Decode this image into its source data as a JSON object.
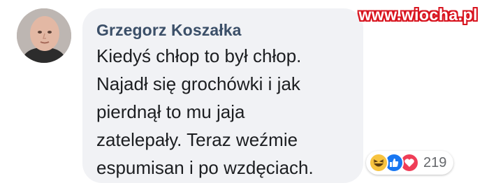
{
  "watermark": "www.wiocha.pl",
  "comment": {
    "author": "Grzegorz Koszałka",
    "lines": [
      "Kiedyś chłop to był chłop.",
      "Najadł się grochówki i jak",
      "pierdnął to mu jaja",
      "zatelepały. Teraz weźmie",
      "espumisan i po wzdęciach."
    ]
  },
  "reactions": {
    "icons": [
      "haha-icon",
      "like-icon",
      "love-icon"
    ],
    "count": "219"
  },
  "colors": {
    "bubble": "#f1f2f5",
    "author": "#3b4f68",
    "like": "#1877f2",
    "love": "#ef3d57",
    "haha": "#f7c33f",
    "watermark": "#d8141f"
  }
}
